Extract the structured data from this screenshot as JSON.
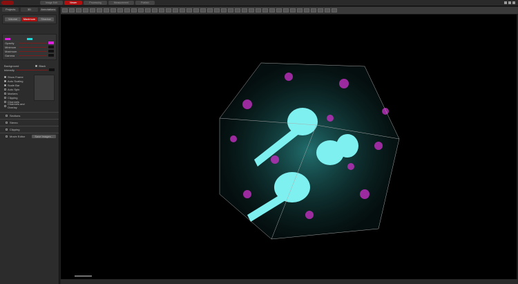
{
  "top_tabs": [
    {
      "label": "Image Edit"
    },
    {
      "label": "Viewer",
      "active": true
    },
    {
      "label": "Processing"
    },
    {
      "label": "Measurement"
    },
    {
      "label": "Publish"
    }
  ],
  "side_tabs": [
    {
      "label": "Projects"
    },
    {
      "label": "3D"
    },
    {
      "label": "Annotations"
    }
  ],
  "render_modes": [
    {
      "label": "Volume"
    },
    {
      "label": "Maximum",
      "active": true
    },
    {
      "label": "Shadow"
    }
  ],
  "channel_sliders": [
    {
      "label": "Opacity"
    },
    {
      "label": "Minimum"
    },
    {
      "label": "Maximum"
    },
    {
      "label": "Gamma"
    }
  ],
  "channel_colors": {
    "ch1": "#e020e0",
    "ch2": "#20d8d8"
  },
  "background": {
    "label": "Background",
    "value": "Black"
  },
  "intensity": {
    "label": "Intensity"
  },
  "options": [
    {
      "label": "Show Frame",
      "checked": true
    },
    {
      "label": "Auto Scaling",
      "checked": true
    },
    {
      "label": "Scale Bar",
      "checked": true
    },
    {
      "label": "Auto Spin",
      "checked": false
    },
    {
      "label": "Markers",
      "checked": false
    },
    {
      "label": "Clipping",
      "checked": false
    },
    {
      "label": "Channels",
      "checked": false
    },
    {
      "label": "Channels and Overlay",
      "checked": false
    }
  ],
  "sections": [
    {
      "label": "Sections"
    },
    {
      "label": "Stereo"
    },
    {
      "label": "Clipping"
    },
    {
      "label": "Movie Editor",
      "button": "Save Images..."
    }
  ],
  "accent": "#b01010"
}
